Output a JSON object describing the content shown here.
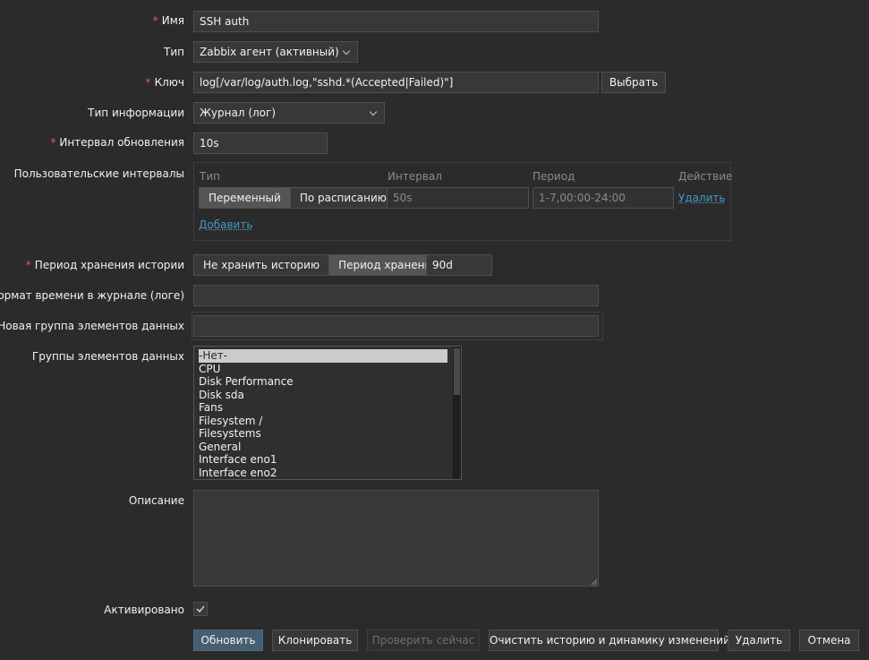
{
  "form": {
    "name": {
      "label": "Имя",
      "value": "SSH auth"
    },
    "type": {
      "label": "Тип",
      "value": "Zabbix агент (активный)"
    },
    "key": {
      "label": "Ключ",
      "value": "log[/var/log/auth.log,\"sshd.*(Accepted|Failed)\"]",
      "select_button": "Выбрать"
    },
    "info_type": {
      "label": "Тип информации",
      "value": "Журнал (лог)"
    },
    "update_interval": {
      "label": "Интервал обновления",
      "value": "10s"
    },
    "custom_intervals": {
      "label": "Пользовательские интервалы",
      "headers": {
        "type": "Тип",
        "interval": "Интервал",
        "period": "Период",
        "action": "Действие"
      },
      "row": {
        "type_options": [
          "Переменный",
          "По расписанию"
        ],
        "type_selected": "Переменный",
        "interval": "50s",
        "period": "1-7,00:00-24:00",
        "remove": "Удалить"
      },
      "add": "Добавить"
    },
    "history": {
      "label": "Период хранения истории",
      "options": [
        "Не хранить историю",
        "Период хранения"
      ],
      "selected": "Период хранения",
      "value": "90d"
    },
    "log_time_format": {
      "label": "Формат времени в журнале (логе)",
      "value": ""
    },
    "new_group": {
      "label": "Новая группа элементов данных",
      "value": ""
    },
    "groups": {
      "label": "Группы элементов данных",
      "items": [
        "-Нет-",
        "CPU",
        "Disk Performance",
        "Disk sda",
        "Fans",
        "Filesystem /",
        "Filesystems",
        "General",
        "Interface eno1",
        "Interface eno2"
      ],
      "selected": "-Нет-"
    },
    "description": {
      "label": "Описание",
      "value": ""
    },
    "enabled": {
      "label": "Активировано",
      "checked": true
    }
  },
  "buttons": {
    "update": "Обновить",
    "clone": "Клонировать",
    "check_now": "Проверить сейчас",
    "clear_history": "Очистить историю и динамику изменений",
    "delete": "Удалить",
    "cancel": "Отмена"
  },
  "colors": {
    "background": "#2b2b2b",
    "required": "#e45959",
    "link": "#4796c4",
    "primary": "#455e72"
  }
}
